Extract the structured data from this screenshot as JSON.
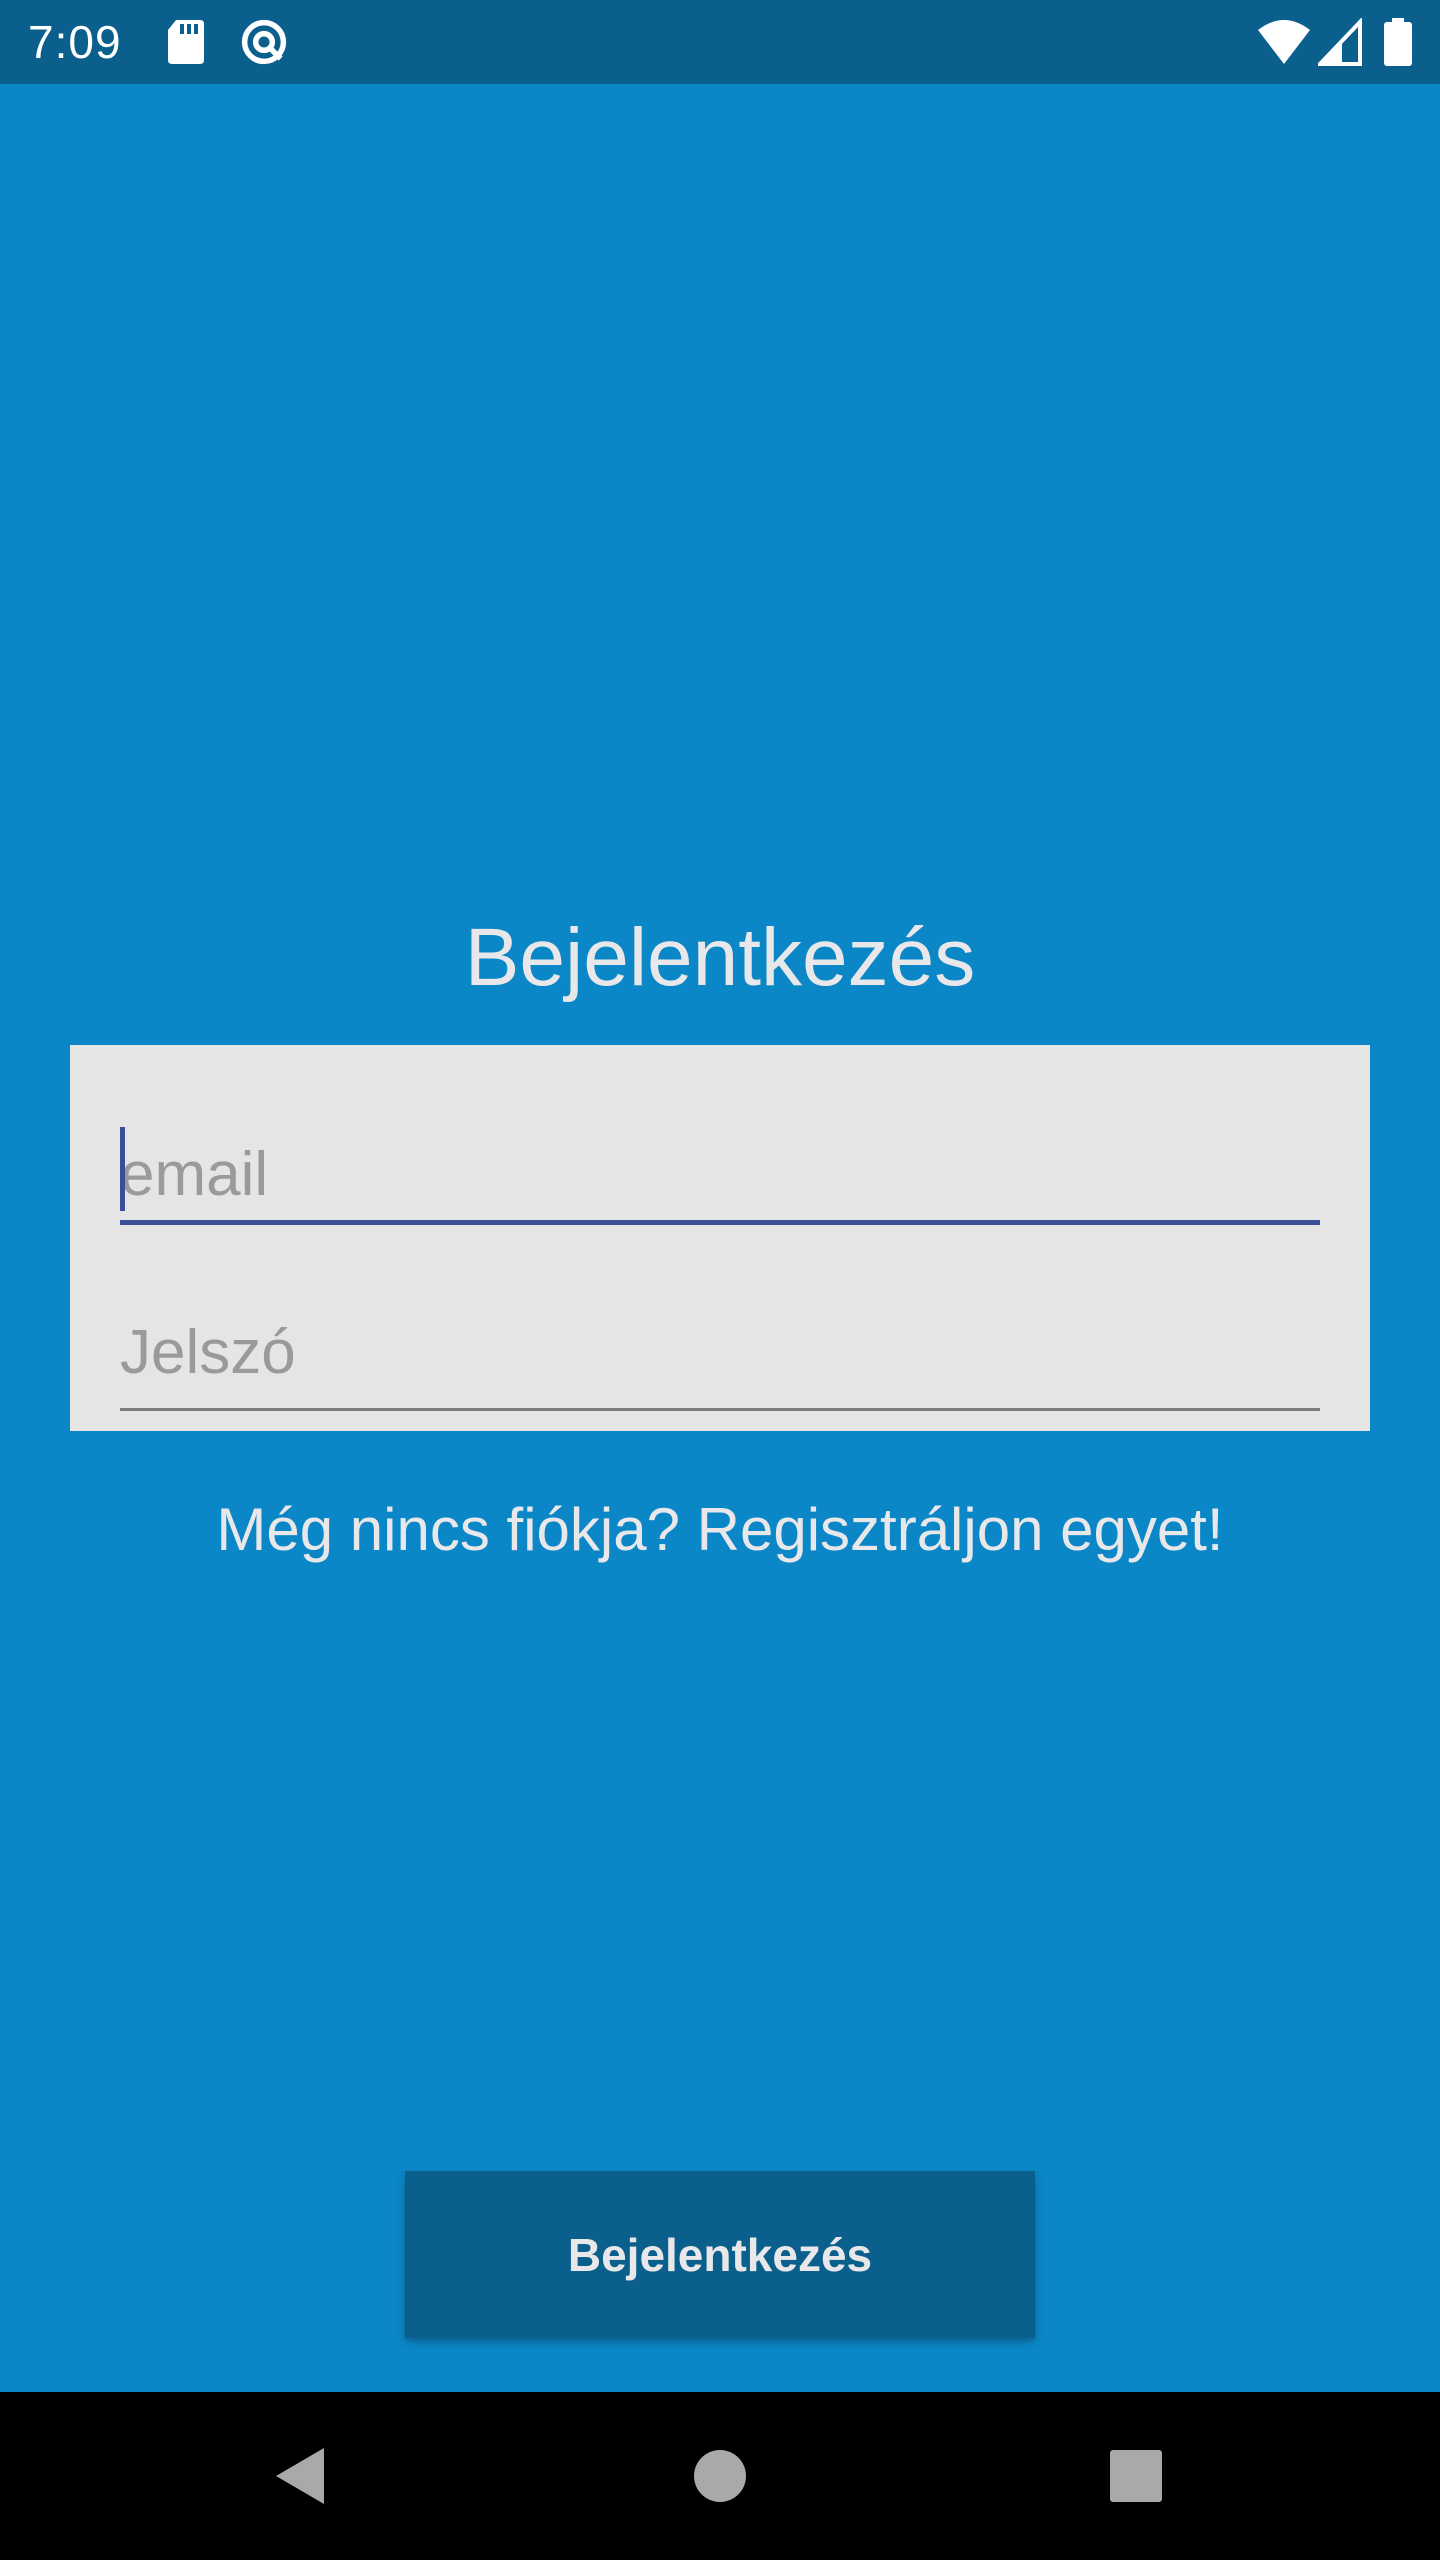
{
  "status_bar": {
    "time": "7:09",
    "icons": [
      "sd-card-icon",
      "sync-icon",
      "wifi-icon",
      "signal-icon",
      "battery-icon"
    ]
  },
  "login": {
    "title": "Bejelentkezés",
    "email_placeholder": "email",
    "email_value": "",
    "password_placeholder": "Jelszó",
    "password_value": "",
    "register_link": "Még nincs fiókja? Regisztráljon egyet!",
    "button_label": "Bejelentkezés"
  },
  "nav_bar": {
    "icons": [
      "back-icon",
      "home-icon",
      "recents-icon"
    ]
  },
  "colors": {
    "background": "#0b87c8",
    "status_bar": "#0a5f8c",
    "card": "#e6e5e6",
    "focus_underline": "#3b4f99",
    "button": "#0a5f8c"
  }
}
